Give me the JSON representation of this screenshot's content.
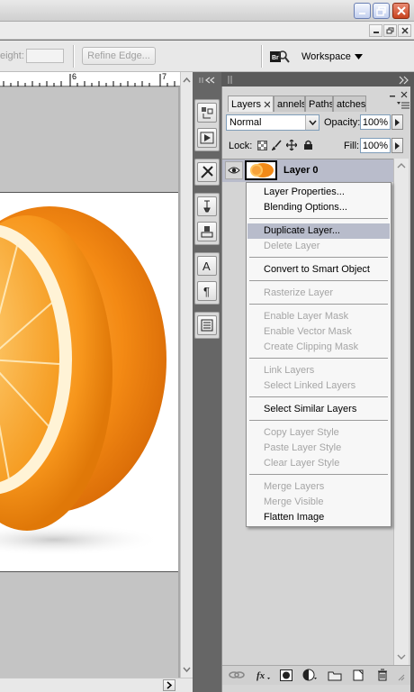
{
  "options_bar": {
    "height_label": "eight:",
    "height_value": "",
    "refine_edge": "Refine Edge...",
    "workspace": "Workspace",
    "bridge_icon": "bridge-icon"
  },
  "ruler": {
    "visible_mark": "6",
    "visible_mark_2": "7"
  },
  "layers_panel": {
    "tabs": [
      "Layers",
      "annels",
      "Paths",
      "atches"
    ],
    "blend_mode": "Normal",
    "opacity_label": "Opacity:",
    "opacity_value": "100%",
    "lock_label": "Lock:",
    "fill_label": "Fill:",
    "fill_value": "100%",
    "layer_name": "Layer 0"
  },
  "context_menu": {
    "items": [
      {
        "label": "Layer Properties...",
        "enabled": true
      },
      {
        "label": "Blending Options...",
        "enabled": true
      },
      {
        "label": "Duplicate Layer...",
        "enabled": true,
        "highlighted": true
      },
      {
        "label": "Delete Layer",
        "enabled": false
      },
      {
        "label": "Convert to Smart Object",
        "enabled": true
      },
      {
        "label": "Rasterize Layer",
        "enabled": false
      },
      {
        "label": "Enable Layer Mask",
        "enabled": false
      },
      {
        "label": "Enable Vector Mask",
        "enabled": false
      },
      {
        "label": "Create Clipping Mask",
        "enabled": false
      },
      {
        "label": "Link Layers",
        "enabled": false
      },
      {
        "label": "Select Linked Layers",
        "enabled": false
      },
      {
        "label": "Select Similar Layers",
        "enabled": true
      },
      {
        "label": "Copy Layer Style",
        "enabled": false
      },
      {
        "label": "Paste Layer Style",
        "enabled": false
      },
      {
        "label": "Clear Layer Style",
        "enabled": false
      },
      {
        "label": "Merge Layers",
        "enabled": false
      },
      {
        "label": "Merge Visible",
        "enabled": false
      },
      {
        "label": "Flatten Image",
        "enabled": true
      }
    ]
  },
  "colors": {
    "menu_highlight": "#b8bccb",
    "disabled_text": "#a5a5a5",
    "orange": "#f28a17"
  }
}
